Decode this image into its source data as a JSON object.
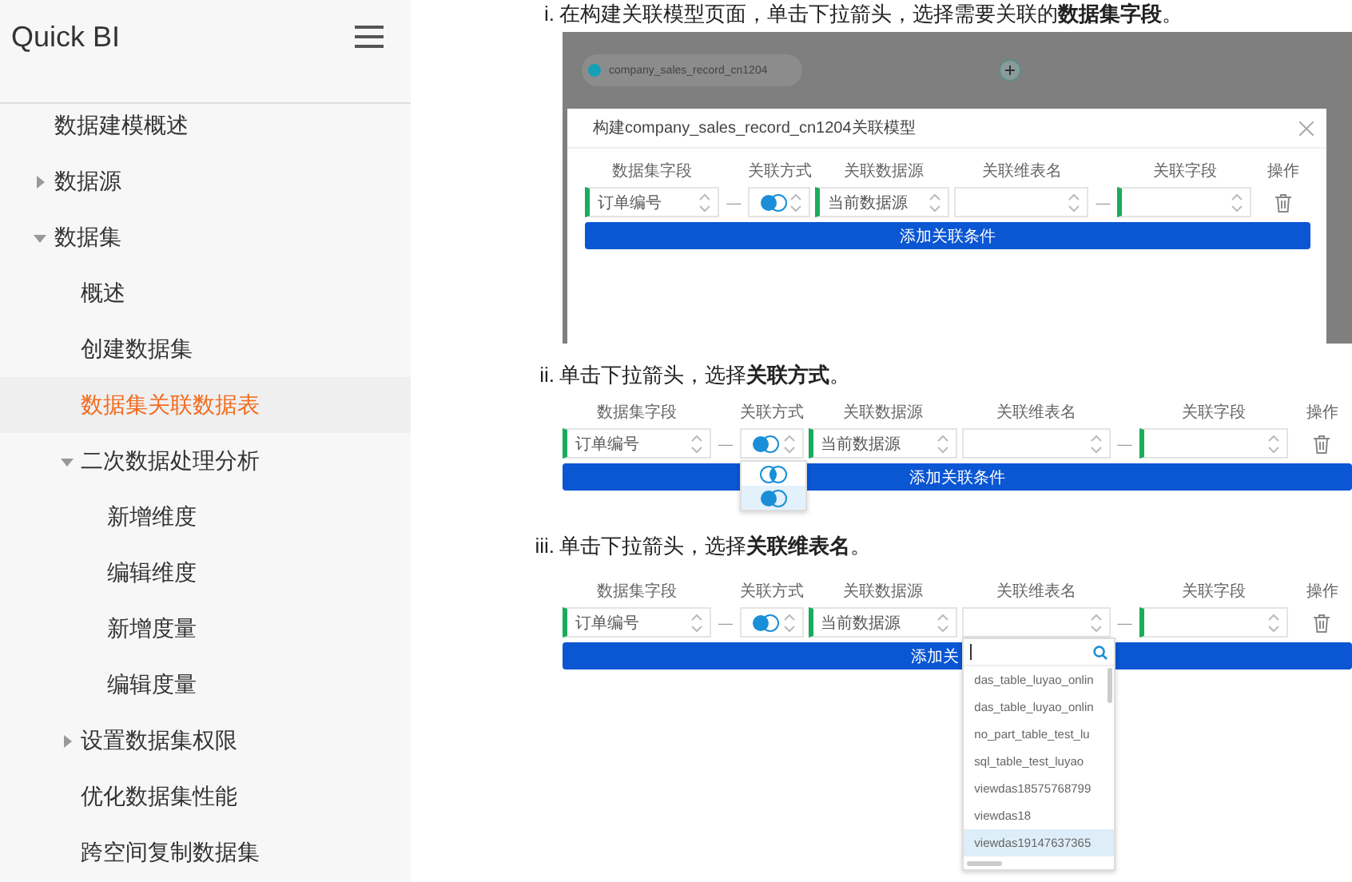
{
  "sidebar": {
    "title": "Quick BI",
    "items": [
      {
        "label": "数据建模概述",
        "selected": false
      },
      {
        "label": "数据源",
        "expanded": false,
        "selected": false
      },
      {
        "label": "数据集",
        "expanded": true,
        "selected": false,
        "children": [
          {
            "label": "概述",
            "selected": false
          },
          {
            "label": "创建数据集",
            "selected": false
          },
          {
            "label": "数据集关联数据表",
            "selected": true
          },
          {
            "label": "二次数据处理分析",
            "expanded": true,
            "selected": false,
            "children": [
              {
                "label": "新增维度",
                "selected": false
              },
              {
                "label": "编辑维度",
                "selected": false
              },
              {
                "label": "新增度量",
                "selected": false
              },
              {
                "label": "编辑度量",
                "selected": false
              }
            ]
          },
          {
            "label": "设置数据集权限",
            "expanded": false,
            "selected": false
          },
          {
            "label": "优化数据集性能",
            "selected": false
          },
          {
            "label": "跨空间复制数据集",
            "selected": false
          }
        ]
      }
    ]
  },
  "steps": [
    {
      "marker": "i.",
      "text": "在构建关联模型页面，单击下拉箭头，选择需要关联的**数据集字段**。",
      "screenshot": {
        "kind": "modal",
        "backdrop_node": "company_sales_record_cn1204",
        "modal_title": "构建company_sales_record_cn1204关联模型",
        "columns": [
          {
            "header": "数据集字段",
            "kind": "select",
            "value": "订单编号",
            "flagged": true
          },
          {
            "header": "关联方式",
            "kind": "join",
            "separator": "—"
          },
          {
            "header": "关联数据源",
            "kind": "select",
            "value": "当前数据源",
            "flagged": true
          },
          {
            "header": "关联维表名",
            "kind": "select",
            "flagged": false
          },
          {
            "header": "关联字段",
            "kind": "select",
            "flagged": true,
            "separator": "—"
          },
          {
            "header": "操作",
            "kind": "delete"
          }
        ],
        "button": "添加关联条件"
      }
    },
    {
      "marker": "ii.",
      "text": "单击下拉箭头，选择**关联方式**。",
      "screenshot": {
        "kind": "form",
        "columns": [
          {
            "header": "数据集字段",
            "kind": "select",
            "value": "订单编号",
            "flagged": true
          },
          {
            "header": "关联方式",
            "kind": "join",
            "separator": "—",
            "dropdown": {
              "kind": "join-types",
              "options": [
                {
                  "selected": false
                },
                {
                  "selected": true
                }
              ]
            }
          },
          {
            "header": "关联数据源",
            "kind": "select",
            "value": "当前数据源",
            "flagged": true
          },
          {
            "header": "关联维表名",
            "kind": "select",
            "flagged": false
          },
          {
            "header": "关联字段",
            "kind": "select",
            "flagged": true,
            "separator": "—"
          },
          {
            "header": "操作",
            "kind": "delete"
          }
        ],
        "button": "添加关联条件"
      }
    },
    {
      "marker": "iii.",
      "text": "单击下拉箭头，选择**关联维表名**。",
      "screenshot": {
        "kind": "form",
        "columns": [
          {
            "header": "数据集字段",
            "kind": "select",
            "value": "订单编号",
            "flagged": true
          },
          {
            "header": "关联方式",
            "kind": "join",
            "separator": "—"
          },
          {
            "header": "关联数据源",
            "kind": "select",
            "value": "当前数据源",
            "flagged": true
          },
          {
            "header": "关联维表名",
            "kind": "select",
            "flagged": false,
            "dropdown": {
              "kind": "list",
              "options": [
                {
                  "label": "das_table_luyao_onlin",
                  "selected": false
                },
                {
                  "label": "das_table_luyao_onlin",
                  "selected": false
                },
                {
                  "label": "no_part_table_test_lu",
                  "selected": false
                },
                {
                  "label": "sql_table_test_luyao",
                  "selected": false
                },
                {
                  "label": "viewdas18575768799",
                  "selected": false
                },
                {
                  "label": "viewdas18",
                  "selected": false
                },
                {
                  "label": "viewdas19147637365",
                  "selected": true
                }
              ]
            }
          },
          {
            "header": "关联字段",
            "kind": "select",
            "flagged": true,
            "separator": "—"
          },
          {
            "header": "操作",
            "kind": "delete"
          }
        ],
        "button": "添加关"
      }
    }
  ]
}
